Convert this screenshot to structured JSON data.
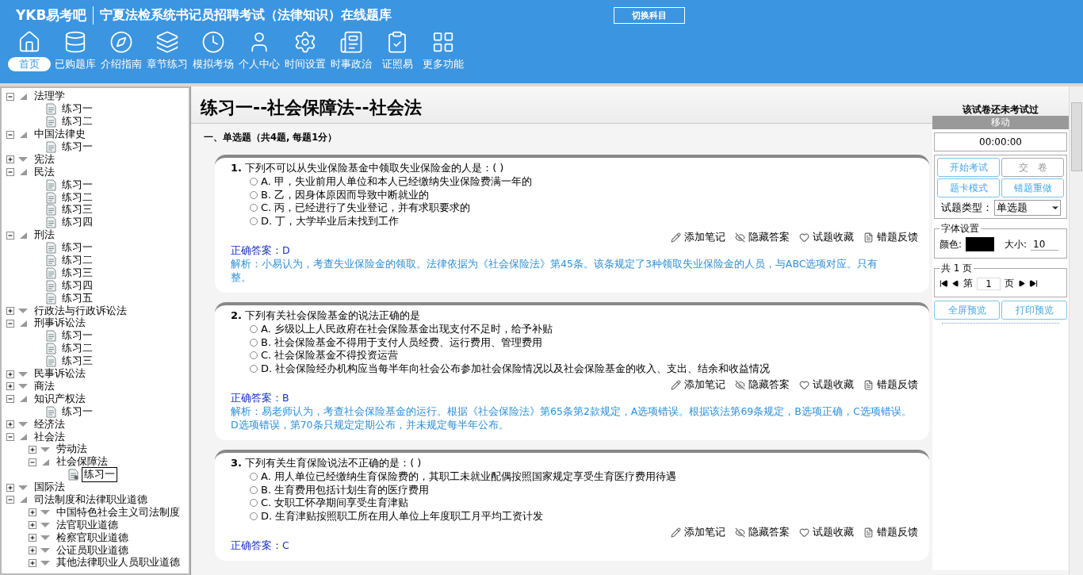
{
  "header": {
    "logo": "YKB易考吧",
    "title": "宁夏法检系统书记员招聘考试（法律知识）在线题库",
    "switch_button": "切换科目"
  },
  "nav": [
    {
      "label": "首页",
      "selected": true
    },
    {
      "label": "已购题库",
      "selected": false
    },
    {
      "label": "介绍指南",
      "selected": false
    },
    {
      "label": "章节练习",
      "selected": false
    },
    {
      "label": "模拟考场",
      "selected": false
    },
    {
      "label": "个人中心",
      "selected": false
    },
    {
      "label": "时间设置",
      "selected": false
    },
    {
      "label": "时事政治",
      "selected": false
    },
    {
      "label": "证照易",
      "selected": false
    },
    {
      "label": "更多功能",
      "selected": false
    }
  ],
  "tree": [
    {
      "label": "法理学",
      "expanded": true,
      "children": [
        {
          "label": "练习一",
          "selected": false
        },
        {
          "label": "练习二",
          "selected": false
        }
      ]
    },
    {
      "label": "中国法律史",
      "expanded": true,
      "children": [
        {
          "label": "练习一",
          "selected": false
        }
      ]
    },
    {
      "label": "宪法",
      "expanded": false
    },
    {
      "label": "民法",
      "expanded": true,
      "children": [
        {
          "label": "练习一",
          "selected": false
        },
        {
          "label": "练习二",
          "selected": false
        },
        {
          "label": "练习三",
          "selected": false
        },
        {
          "label": "练习四",
          "selected": false
        }
      ]
    },
    {
      "label": "刑法",
      "expanded": true,
      "children": [
        {
          "label": "练习一",
          "selected": false
        },
        {
          "label": "练习二",
          "selected": false
        },
        {
          "label": "练习三",
          "selected": false
        },
        {
          "label": "练习四",
          "selected": false
        },
        {
          "label": "练习五",
          "selected": false
        }
      ]
    },
    {
      "label": "行政法与行政诉讼法",
      "expanded": false
    },
    {
      "label": "刑事诉讼法",
      "expanded": true,
      "children": [
        {
          "label": "练习一",
          "selected": false
        },
        {
          "label": "练习二",
          "selected": false
        },
        {
          "label": "练习三",
          "selected": false
        }
      ]
    },
    {
      "label": "民事诉讼法",
      "expanded": false
    },
    {
      "label": "商法",
      "expanded": false
    },
    {
      "label": "知识产权法",
      "expanded": true,
      "children": [
        {
          "label": "练习一",
          "selected": false
        }
      ]
    },
    {
      "label": "经济法",
      "expanded": false
    },
    {
      "label": "社会法",
      "expanded": true,
      "children": [
        {
          "label": "劳动法",
          "expanded": false
        },
        {
          "label": "社会保障法",
          "expanded": true,
          "children": [
            {
              "label": "练习一",
              "selected": true
            }
          ]
        }
      ]
    },
    {
      "label": "国际法",
      "expanded": false
    },
    {
      "label": "司法制度和法律职业道德",
      "expanded": true,
      "children": [
        {
          "label": "中国特色社会主义司法制度",
          "expanded": false
        },
        {
          "label": "法官职业道德",
          "expanded": false
        },
        {
          "label": "检察官职业道德",
          "expanded": false
        },
        {
          "label": "公证员职业道德",
          "expanded": false
        },
        {
          "label": "其他法律职业人员职业道德",
          "expanded": false
        }
      ]
    }
  ],
  "exam": {
    "title": "练习一--社会保障法--社会法",
    "status": "该试卷还未考试过",
    "section": "一、单选题（共4题, 每题1分）",
    "questions": [
      {
        "number": "1.",
        "text": "下列不可以从失业保险基金中领取失业保险金的人是：( )",
        "options": [
          {
            "letter": "A.",
            "text": "甲，失业前用人单位和本人已经缴纳失业保险费满一年的",
            "selected": false
          },
          {
            "letter": "B.",
            "text": "乙，因身体原因而导致中断就业的",
            "selected": false
          },
          {
            "letter": "C.",
            "text": "丙，已经进行了失业登记，并有求职要求的",
            "selected": false
          },
          {
            "letter": "D.",
            "text": "丁，大学毕业后未找到工作",
            "selected": false
          }
        ],
        "actions": [
          {
            "kind": "note",
            "label": "添加笔记"
          },
          {
            "kind": "hide",
            "label": "隐藏答案"
          },
          {
            "kind": "favorite",
            "label": "试题收藏"
          },
          {
            "kind": "report",
            "label": "错题反馈"
          }
        ],
        "answer": "正确答案：D",
        "analysis": [
          "解析：小易认为，考查失业保险金的领取。法律依据为《社会保险法》第45条。该条规定了3种领取失业保险金的人员，与ABC选项对应。只有",
          "整。"
        ]
      },
      {
        "number": "2.",
        "text": "下列有关社会保险基金的说法正确的是",
        "options": [
          {
            "letter": "A.",
            "text": "乡级以上人民政府在社会保险基金出现支付不足时，给予补贴",
            "selected": false
          },
          {
            "letter": "B.",
            "text": "社会保险基金不得用于支付人员经费、运行费用、管理费用",
            "selected": false
          },
          {
            "letter": "C.",
            "text": "社会保险基金不得投资运营",
            "selected": false
          },
          {
            "letter": "D.",
            "text": "社会保险经办机构应当每半年向社会公布参加社会保险情况以及社会保险基金的收入、支出、结余和收益情况",
            "selected": false
          }
        ],
        "actions": [
          {
            "kind": "note",
            "label": "添加笔记"
          },
          {
            "kind": "hide",
            "label": "隐藏答案"
          },
          {
            "kind": "favorite",
            "label": "试题收藏"
          },
          {
            "kind": "report",
            "label": "错题反馈"
          }
        ],
        "answer": "正确答案：B",
        "analysis": [
          "解析：易老师认为，考查社会保险基金的运行。根据《社会保险法》第65条第2款规定，A选项错误。根据该法第69条规定，B选项正确，C选项错误。D选项错误，第70条只规定定期公布，并未规定每半年公布。"
        ]
      },
      {
        "number": "3.",
        "text": "下列有关生育保险说法不正确的是：( )",
        "options": [
          {
            "letter": "A.",
            "text": "用人单位已经缴纳生育保险费的，其职工未就业配偶按照国家规定享受生育医疗费用待遇",
            "selected": false
          },
          {
            "letter": "B.",
            "text": "生育费用包括计划生育的医疗费用",
            "selected": false
          },
          {
            "letter": "C.",
            "text": "女职工怀孕期间享受生育津贴",
            "selected": false
          },
          {
            "letter": "D.",
            "text": "生育津贴按照职工所在用人单位上年度职工月平均工资计发",
            "selected": false
          }
        ],
        "actions": [
          {
            "kind": "note",
            "label": "添加笔记"
          },
          {
            "kind": "hide",
            "label": "隐藏答案"
          },
          {
            "kind": "favorite",
            "label": "试题收藏"
          },
          {
            "kind": "report",
            "label": "错题反馈"
          }
        ],
        "answer": "正确答案：C"
      }
    ]
  },
  "panel": {
    "move_label": "移动",
    "timer": "00:00:00",
    "buttons": [
      {
        "label": "开始考试",
        "disabled": false
      },
      {
        "label": "交　卷",
        "disabled": true
      },
      {
        "label": "题卡模式",
        "disabled": false
      },
      {
        "label": "错题重做",
        "disabled": false
      }
    ],
    "type_label": "试题类型：",
    "type_value": "单选题",
    "font_legend": "字体设置",
    "color_label": "颜色:",
    "color": "#000000",
    "size_label": "大小:",
    "size_value": "10",
    "pager_legend": "共 1 页",
    "page_prefix": "第",
    "page_value": "1",
    "page_suffix": "页",
    "preview_buttons": [
      "全屏预览",
      "打印预览"
    ]
  }
}
